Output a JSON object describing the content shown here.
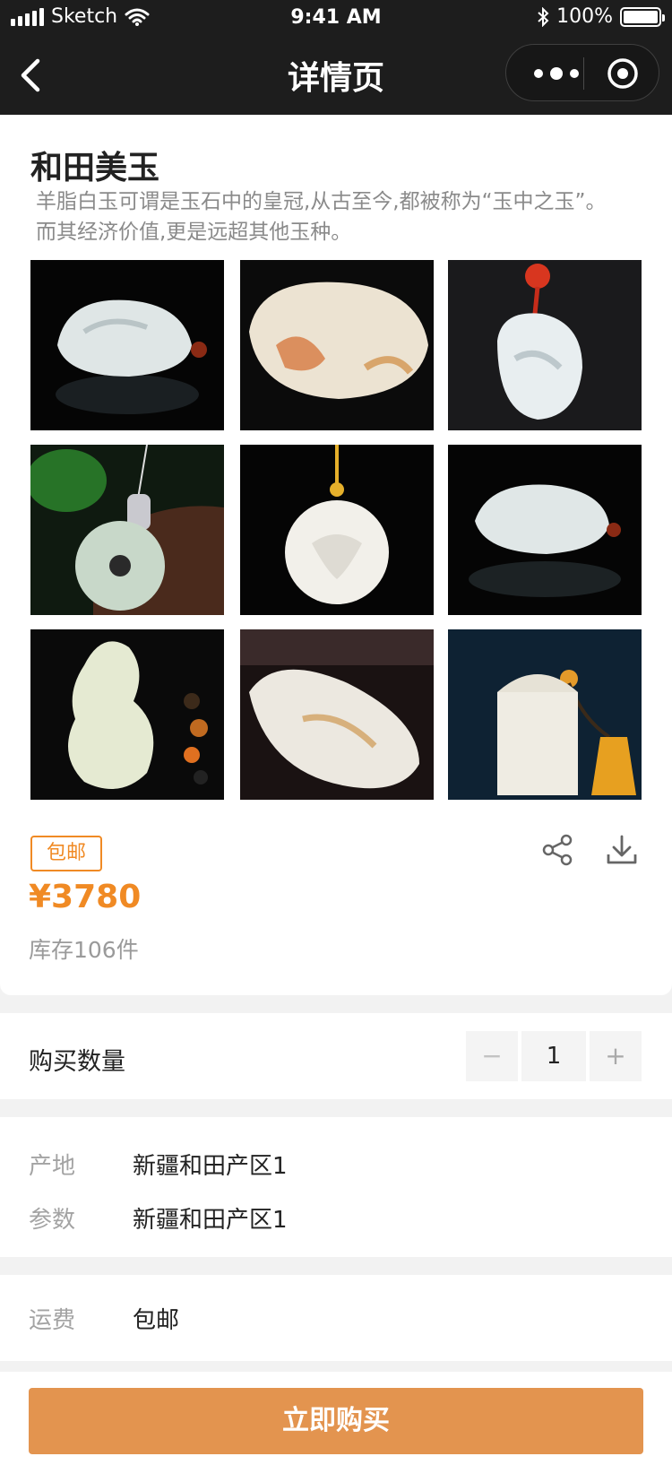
{
  "status_bar": {
    "carrier": "Sketch",
    "time": "9:41 AM",
    "battery": "100%"
  },
  "nav": {
    "title": "详情页"
  },
  "product": {
    "name": "和田美玉",
    "description": "羊脂白玉可谓是玉石中的皇冠,从古至今,都被称为“玉中之玉”。而其经济价值,更是远超其他玉种。",
    "images": [
      {
        "alt": "jade-ruyi-carving"
      },
      {
        "alt": "jade-pebble-carving"
      },
      {
        "alt": "jade-pendant-red-bead"
      },
      {
        "alt": "jade-disc-pendant-necklace"
      },
      {
        "alt": "jade-flower-pendant"
      },
      {
        "alt": "jade-carving-reflection"
      },
      {
        "alt": "jade-gourd-pendant"
      },
      {
        "alt": "jade-horse-carving"
      },
      {
        "alt": "jade-seal-tassel"
      }
    ],
    "badge": "包邮",
    "price": "¥3780",
    "stock": "库存106件"
  },
  "quantity": {
    "label": "购买数量",
    "minus": "−",
    "value": "1",
    "plus": "+"
  },
  "specs": [
    {
      "key": "产地",
      "value": "新疆和田产区1"
    },
    {
      "key": "参数",
      "value": "新疆和田产区1"
    }
  ],
  "shipping": {
    "key": "运费",
    "value": "包邮"
  },
  "buy_button": "立即购买",
  "colors": {
    "accent": "#f08a24",
    "button": "#e3944f",
    "nav_bg": "#1d1d1d"
  }
}
